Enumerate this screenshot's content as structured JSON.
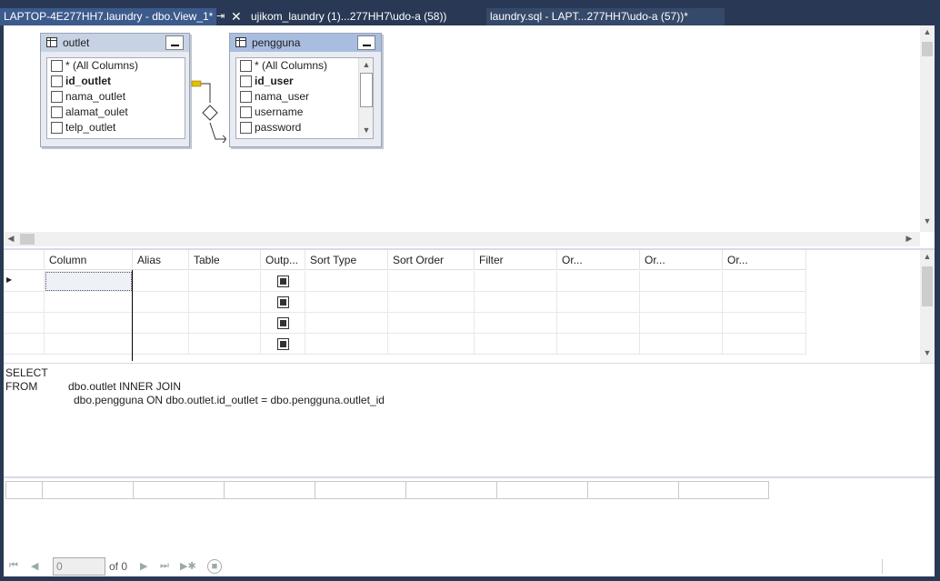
{
  "tabs": [
    {
      "title": "LAPTOP-4E277HH7.laundry - dbo.View_1*",
      "active": true
    },
    {
      "title": "ujikom_laundry (1)...277HH7\\udo-a (58))",
      "active": false
    },
    {
      "title": "laundry.sql - LAPT...277HH7\\udo-a (57))*",
      "active": false
    }
  ],
  "tab_icons": {
    "pin": "pin-icon",
    "close": "close-icon"
  },
  "diagram": {
    "tables": [
      {
        "name": "outlet",
        "columns": [
          {
            "label": "* (All Columns)",
            "key": false
          },
          {
            "label": "id_outlet",
            "key": true
          },
          {
            "label": "nama_outlet",
            "key": false
          },
          {
            "label": "alamat_oulet",
            "key": false
          },
          {
            "label": "telp_outlet",
            "key": false
          }
        ]
      },
      {
        "name": "pengguna",
        "columns": [
          {
            "label": "* (All Columns)",
            "key": false
          },
          {
            "label": "id_user",
            "key": true
          },
          {
            "label": "nama_user",
            "key": false
          },
          {
            "label": "username",
            "key": false
          },
          {
            "label": "password",
            "key": false
          }
        ]
      }
    ]
  },
  "criteria_grid": {
    "headers": [
      "Column",
      "Alias",
      "Table",
      "Outp...",
      "Sort Type",
      "Sort Order",
      "Filter",
      "Or...",
      "Or...",
      "Or..."
    ],
    "rows": 4
  },
  "sql": {
    "line1_kw": "SELECT",
    "line2_kw": "FROM",
    "line2_text": "dbo.outlet INNER JOIN",
    "line3_text": "dbo.pengguna ON dbo.outlet.id_outlet = dbo.pengguna.outlet_id"
  },
  "results_nav": {
    "position_value": "0",
    "of_label": "of 0"
  },
  "colors": {
    "chrome": "#293955",
    "active_tab": "#3c5a8c",
    "relation": "#e0c000"
  }
}
